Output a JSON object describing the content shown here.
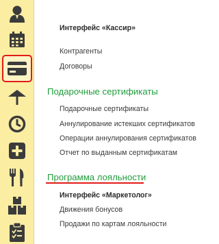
{
  "sidebar": {
    "items": [
      {
        "icon": "person-icon"
      },
      {
        "icon": "calendar-icon"
      },
      {
        "icon": "credit-card-icon",
        "selected": true
      },
      {
        "icon": "umbrella-icon"
      },
      {
        "icon": "clock-icon"
      },
      {
        "icon": "plus-icon"
      },
      {
        "icon": "fork-knife-icon"
      },
      {
        "icon": "boxes-icon"
      },
      {
        "icon": "clipboard-icon"
      }
    ]
  },
  "content": {
    "interface_cashier": "Интерфейс «Кассир»",
    "links_top": [
      "Контрагенты",
      "Договоры"
    ],
    "gift_section": {
      "title": "Подарочные сертификаты",
      "items": [
        "Подарочные сертификаты",
        "Аннулирование истекших сертификатов",
        "Операции аннулирования сертификатов",
        "Отчет по выданным сертификатам"
      ]
    },
    "loyalty_section": {
      "title": "Программа лояльности",
      "items": [
        "Интерфейс «Маркетолог»",
        "Движения бонусов",
        "Продажи по картам лояльности"
      ]
    }
  },
  "colors": {
    "sidebar_bg": "#fbeda2",
    "icon": "#3b3b3b",
    "section_title": "#1f9d3a",
    "highlight": "#e21a1a"
  }
}
